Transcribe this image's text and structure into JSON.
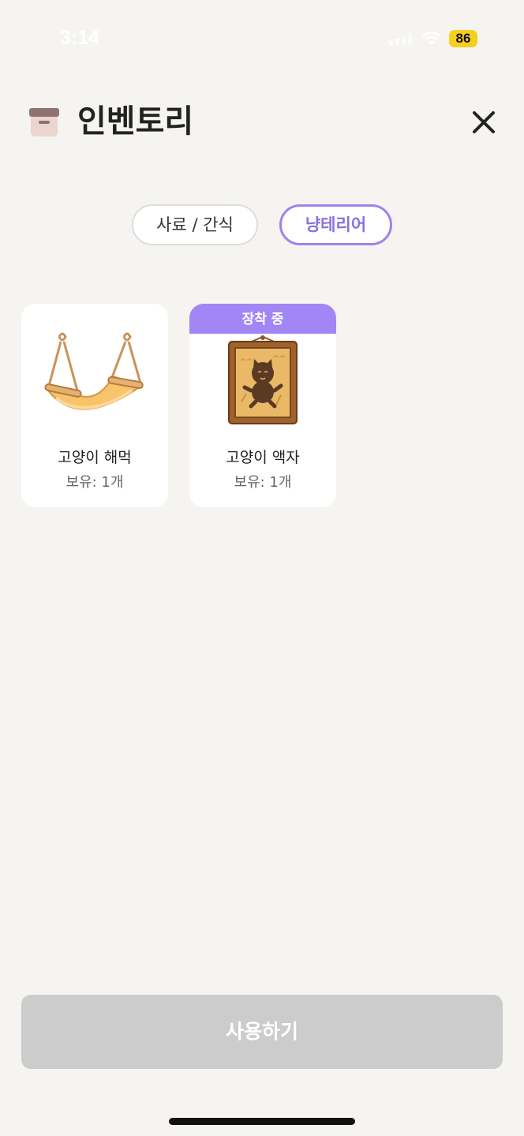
{
  "status_bar": {
    "time": "3:14",
    "battery": "86",
    "battery_color": "#f5cf1f"
  },
  "header": {
    "icon": "archive-box-icon",
    "title": "인벤토리",
    "close_icon": "close-icon"
  },
  "tabs": [
    {
      "label": "사료 / 간식",
      "selected": false
    },
    {
      "label": "냥테리어",
      "selected": true
    }
  ],
  "items": [
    {
      "name": "고양이 해먹",
      "count": "보유: 1개",
      "equipped": false,
      "icon": "hammock-icon"
    },
    {
      "name": "고양이 액자",
      "count": "보유: 1개",
      "equipped": true,
      "badge": "장착 중",
      "icon": "cat-picture-frame-icon"
    }
  ],
  "action": {
    "use_label": "사용하기",
    "enabled": false
  },
  "colors": {
    "accent": "#9a84ee",
    "badge": "#a286f5",
    "background": "#f5f4f0",
    "disabled_button": "#cccccc"
  }
}
